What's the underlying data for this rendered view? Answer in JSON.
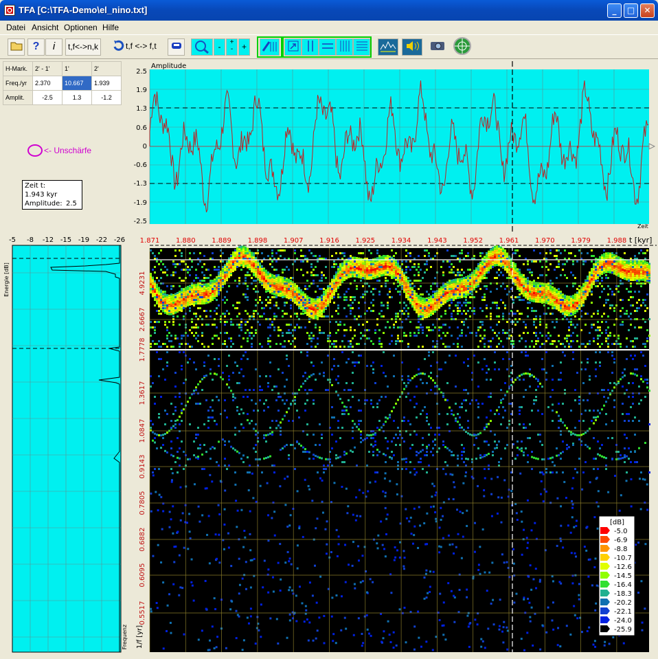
{
  "window": {
    "title": "TFA [C:\\TFA-Demo\\el_nino.txt]",
    "minimize": "_",
    "maximize": "□",
    "close": "✕"
  },
  "menu": [
    "Datei",
    "Ansicht",
    "Optionen",
    "Hilfe"
  ],
  "toolbar": {
    "convert1": "t,f<->n,k",
    "convert2": "t,f <-> f,t",
    "zoom_out": "-",
    "zoom_in_top": "+",
    "zoom_in_bottom": "-",
    "zoom_plus": "+",
    "icons": [
      "open-folder-icon",
      "help-icon",
      "info-icon",
      "rotate-icon",
      "car-icon",
      "magnifier-icon",
      "cursor-marker-icon",
      "marker-arrow-icon",
      "marker-vertical-pair-icon",
      "marker-horizontal-pair-icon",
      "marker-vertical-multi-icon",
      "marker-horizontal-multi-icon",
      "spectrum-icon",
      "speaker-icon",
      "camera-icon",
      "target-icon"
    ]
  },
  "marker_table": {
    "headers": [
      "H-Mark.",
      "2' - 1'",
      "1'",
      "2'"
    ],
    "rows": [
      {
        "label": "Freq./yr",
        "values": [
          "2.370",
          "10.667",
          "1.939"
        ]
      },
      {
        "label": "Amplit.",
        "values": [
          "-2.5",
          "1.3",
          "-1.2"
        ]
      }
    ]
  },
  "blur": {
    "label": "<- Unschärfe",
    "color": "#d000d0"
  },
  "readout": {
    "time_label": "Zeit t:",
    "time_value": "1.943 kyr",
    "amp_label": "Amplitude:",
    "amp_value": "2.5"
  },
  "amplitude_plot": {
    "title": "Amplitude",
    "xlabel": "Zeit",
    "y_ticks": [
      "2.5",
      "1.9",
      "1.3",
      "0.6",
      "0",
      "-0.6",
      "-1.3",
      "-1.9",
      "-2.5"
    ],
    "marker_levels": [
      1.3,
      -1.3
    ],
    "background": "#00f0f0",
    "line_color": "#d02020"
  },
  "time_axis": {
    "ticks": [
      "1.871",
      "1.880",
      "1.889",
      "1.898",
      "1.907",
      "1.916",
      "1.925",
      "1.934",
      "1.943",
      "1.952",
      "1.961",
      "1.970",
      "1.979",
      "1.988"
    ],
    "unit": "t [kyr]",
    "color": "#e00000"
  },
  "energy_plot": {
    "ticks": [
      "-5",
      "-8",
      "-12",
      "-15",
      "-19",
      "-22",
      "-26"
    ],
    "ylabel": "Energie [dB]",
    "xlabel": "Frequenz"
  },
  "spectrogram": {
    "ylabel": "1/f [yr]",
    "y_ticks": [
      "4.9231",
      "2.6667",
      "1.7778",
      "1.3617",
      "1.0847",
      "0.9143",
      "0.7805",
      "0.6882",
      "0.6095",
      "0.5517"
    ]
  },
  "colorbar": {
    "unit": "[dB]",
    "levels": [
      "-5.0",
      "-6.9",
      "-8.8",
      "-10.7",
      "-12.6",
      "-14.5",
      "-16.4",
      "-18.3",
      "-20.2",
      "-22.1",
      "-24.0",
      "-25.9"
    ],
    "colors": [
      "#ff0000",
      "#ff4a00",
      "#ff9400",
      "#ffd000",
      "#e0ff00",
      "#90ff00",
      "#30e030",
      "#20b090",
      "#1070b0",
      "#1040d0",
      "#0020e0",
      "#000000"
    ]
  }
}
